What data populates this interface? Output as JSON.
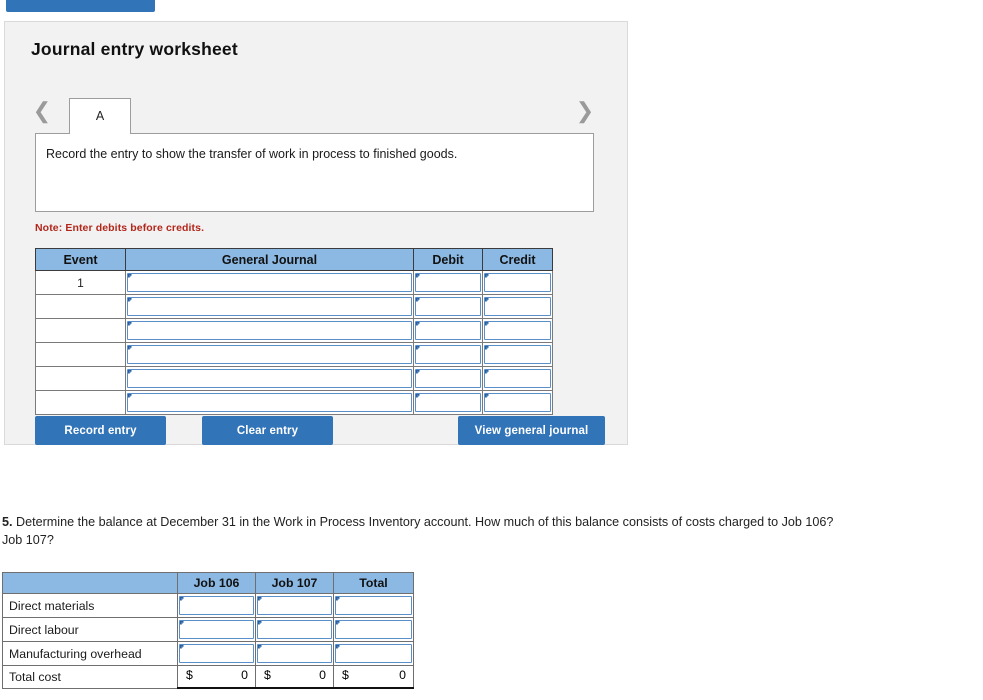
{
  "top_button": {
    "label": ""
  },
  "card": {
    "title": "Journal entry worksheet",
    "tabs": [
      {
        "label": "A",
        "active": true
      }
    ],
    "nav": {
      "prev_icon": "chevron-left-icon",
      "next_icon": "chevron-right-icon"
    },
    "instruction": "Record the entry to show the transfer of work in process to finished goods.",
    "note": "Note: Enter debits before credits.",
    "journal_table": {
      "headers": [
        "Event",
        "General Journal",
        "Debit",
        "Credit"
      ],
      "rows": [
        {
          "event": "1",
          "general_journal": "",
          "debit": "",
          "credit": ""
        },
        {
          "event": "",
          "general_journal": "",
          "debit": "",
          "credit": ""
        },
        {
          "event": "",
          "general_journal": "",
          "debit": "",
          "credit": ""
        },
        {
          "event": "",
          "general_journal": "",
          "debit": "",
          "credit": ""
        },
        {
          "event": "",
          "general_journal": "",
          "debit": "",
          "credit": ""
        },
        {
          "event": "",
          "general_journal": "",
          "debit": "",
          "credit": ""
        }
      ]
    },
    "buttons": {
      "record": "Record entry",
      "clear": "Clear entry",
      "view": "View general journal"
    }
  },
  "question": {
    "number": "5.",
    "text": " Determine the balance at December 31 in the Work in Process Inventory account. How much of this balance consists of costs charged to Job 106? Job 107?"
  },
  "cost_table": {
    "headers": [
      "",
      "Job 106",
      "Job 107",
      "Total"
    ],
    "rows": [
      {
        "label": "Direct materials",
        "job106": "",
        "job107": "",
        "total": ""
      },
      {
        "label": "Direct labour",
        "job106": "",
        "job107": "",
        "total": ""
      },
      {
        "label": "Manufacturing overhead",
        "job106": "",
        "job107": "",
        "total": ""
      }
    ],
    "total_row": {
      "label": "Total cost",
      "currency": "$",
      "job106": "0",
      "job107": "0",
      "total": "0"
    }
  },
  "colors": {
    "button_blue": "#3274b8",
    "header_blue": "#8cb9e4",
    "input_border_blue": "#5b8fc9",
    "note_red": "#b3261a",
    "card_bg": "#f2f2f2"
  }
}
